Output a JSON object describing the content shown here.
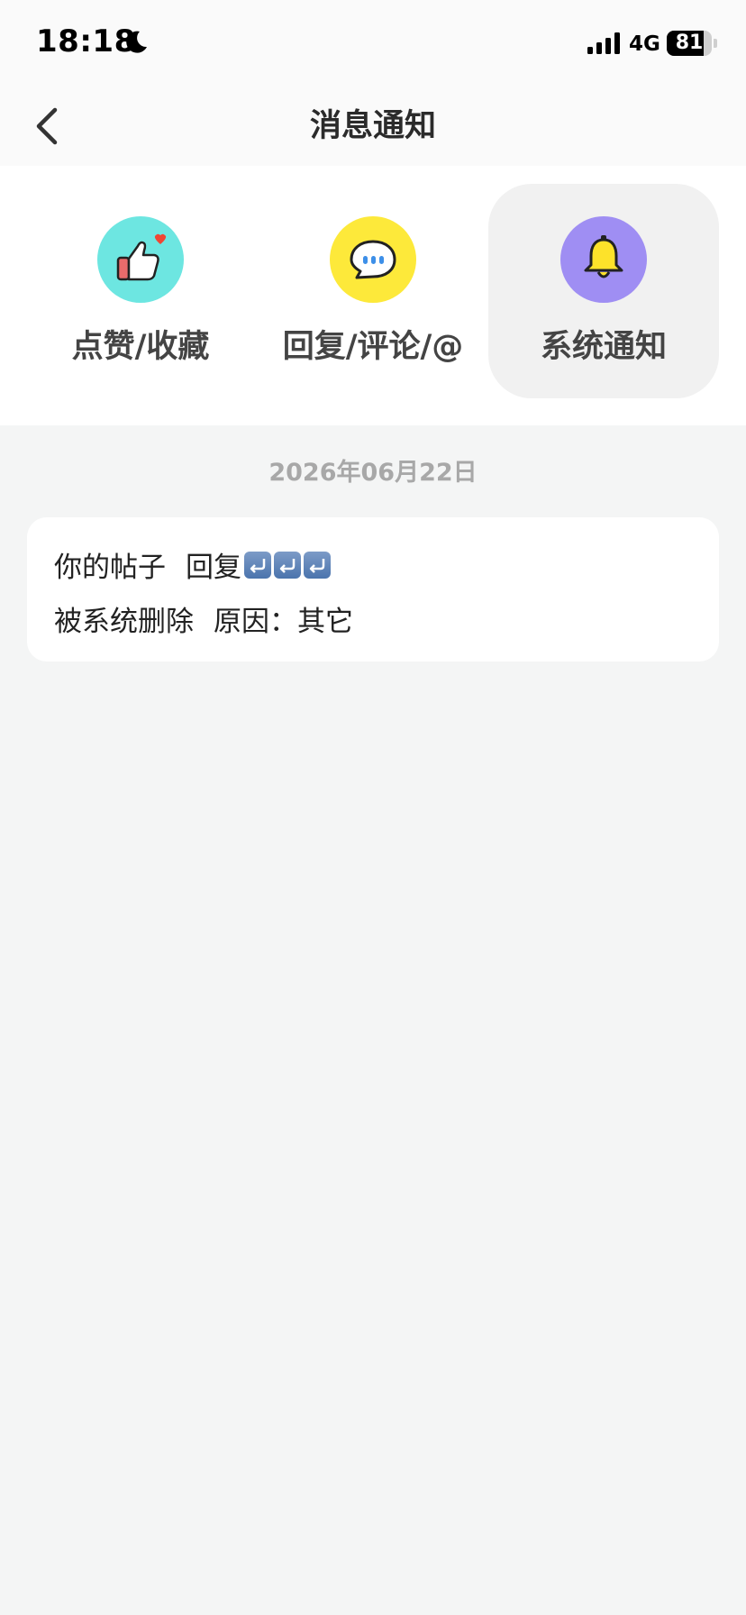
{
  "status_bar": {
    "time": "18:18",
    "network": "4G",
    "battery_level": 81,
    "battery_text": "81"
  },
  "nav": {
    "title": "消息通知",
    "back_icon": "chevron-left-icon"
  },
  "categories": [
    {
      "label": "点赞/收藏",
      "icon": "thumbs-up-heart-icon",
      "color": "#6de6e1",
      "active": false
    },
    {
      "label": "回复/评论/@",
      "icon": "speech-bubble-icon",
      "color": "#fde93a",
      "active": false
    },
    {
      "label": "系统通知",
      "icon": "bell-icon",
      "color": "#9f8ef3",
      "active": true
    }
  ],
  "messages": [
    {
      "date": "2026年06月22日",
      "line1_prefix": "你的帖子",
      "line1_content": "回复",
      "line1_emojis": [
        "reply-arrow-emoji",
        "reply-arrow-emoji",
        "reply-arrow-emoji"
      ],
      "line2_status": "被系统删除",
      "line2_reason": "原因：其它"
    }
  ],
  "colors": {
    "background": "#f4f5f5",
    "active_tab_bg": "#f1f1f1",
    "date_text": "#a8a8a8"
  }
}
